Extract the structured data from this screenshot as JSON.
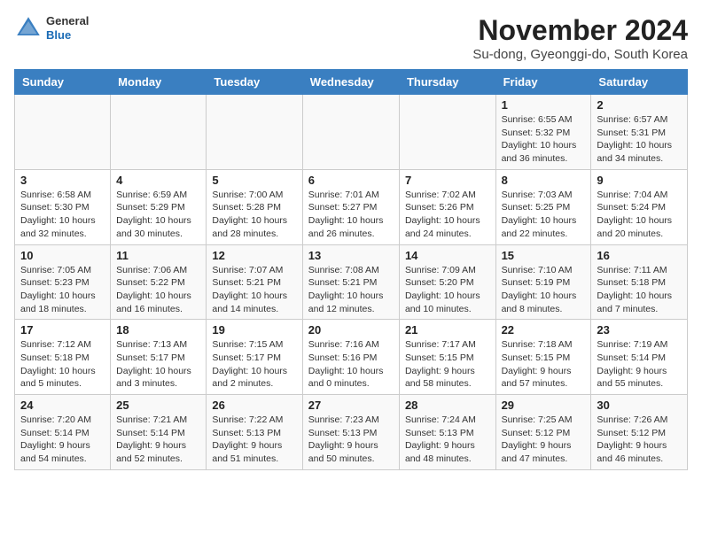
{
  "header": {
    "logo_general": "General",
    "logo_blue": "Blue",
    "title": "November 2024",
    "subtitle": "Su-dong, Gyeonggi-do, South Korea"
  },
  "weekdays": [
    "Sunday",
    "Monday",
    "Tuesday",
    "Wednesday",
    "Thursday",
    "Friday",
    "Saturday"
  ],
  "weeks": [
    [
      {
        "day": "",
        "info": ""
      },
      {
        "day": "",
        "info": ""
      },
      {
        "day": "",
        "info": ""
      },
      {
        "day": "",
        "info": ""
      },
      {
        "day": "",
        "info": ""
      },
      {
        "day": "1",
        "info": "Sunrise: 6:55 AM\nSunset: 5:32 PM\nDaylight: 10 hours and 36 minutes."
      },
      {
        "day": "2",
        "info": "Sunrise: 6:57 AM\nSunset: 5:31 PM\nDaylight: 10 hours and 34 minutes."
      }
    ],
    [
      {
        "day": "3",
        "info": "Sunrise: 6:58 AM\nSunset: 5:30 PM\nDaylight: 10 hours and 32 minutes."
      },
      {
        "day": "4",
        "info": "Sunrise: 6:59 AM\nSunset: 5:29 PM\nDaylight: 10 hours and 30 minutes."
      },
      {
        "day": "5",
        "info": "Sunrise: 7:00 AM\nSunset: 5:28 PM\nDaylight: 10 hours and 28 minutes."
      },
      {
        "day": "6",
        "info": "Sunrise: 7:01 AM\nSunset: 5:27 PM\nDaylight: 10 hours and 26 minutes."
      },
      {
        "day": "7",
        "info": "Sunrise: 7:02 AM\nSunset: 5:26 PM\nDaylight: 10 hours and 24 minutes."
      },
      {
        "day": "8",
        "info": "Sunrise: 7:03 AM\nSunset: 5:25 PM\nDaylight: 10 hours and 22 minutes."
      },
      {
        "day": "9",
        "info": "Sunrise: 7:04 AM\nSunset: 5:24 PM\nDaylight: 10 hours and 20 minutes."
      }
    ],
    [
      {
        "day": "10",
        "info": "Sunrise: 7:05 AM\nSunset: 5:23 PM\nDaylight: 10 hours and 18 minutes."
      },
      {
        "day": "11",
        "info": "Sunrise: 7:06 AM\nSunset: 5:22 PM\nDaylight: 10 hours and 16 minutes."
      },
      {
        "day": "12",
        "info": "Sunrise: 7:07 AM\nSunset: 5:21 PM\nDaylight: 10 hours and 14 minutes."
      },
      {
        "day": "13",
        "info": "Sunrise: 7:08 AM\nSunset: 5:21 PM\nDaylight: 10 hours and 12 minutes."
      },
      {
        "day": "14",
        "info": "Sunrise: 7:09 AM\nSunset: 5:20 PM\nDaylight: 10 hours and 10 minutes."
      },
      {
        "day": "15",
        "info": "Sunrise: 7:10 AM\nSunset: 5:19 PM\nDaylight: 10 hours and 8 minutes."
      },
      {
        "day": "16",
        "info": "Sunrise: 7:11 AM\nSunset: 5:18 PM\nDaylight: 10 hours and 7 minutes."
      }
    ],
    [
      {
        "day": "17",
        "info": "Sunrise: 7:12 AM\nSunset: 5:18 PM\nDaylight: 10 hours and 5 minutes."
      },
      {
        "day": "18",
        "info": "Sunrise: 7:13 AM\nSunset: 5:17 PM\nDaylight: 10 hours and 3 minutes."
      },
      {
        "day": "19",
        "info": "Sunrise: 7:15 AM\nSunset: 5:17 PM\nDaylight: 10 hours and 2 minutes."
      },
      {
        "day": "20",
        "info": "Sunrise: 7:16 AM\nSunset: 5:16 PM\nDaylight: 10 hours and 0 minutes."
      },
      {
        "day": "21",
        "info": "Sunrise: 7:17 AM\nSunset: 5:15 PM\nDaylight: 9 hours and 58 minutes."
      },
      {
        "day": "22",
        "info": "Sunrise: 7:18 AM\nSunset: 5:15 PM\nDaylight: 9 hours and 57 minutes."
      },
      {
        "day": "23",
        "info": "Sunrise: 7:19 AM\nSunset: 5:14 PM\nDaylight: 9 hours and 55 minutes."
      }
    ],
    [
      {
        "day": "24",
        "info": "Sunrise: 7:20 AM\nSunset: 5:14 PM\nDaylight: 9 hours and 54 minutes."
      },
      {
        "day": "25",
        "info": "Sunrise: 7:21 AM\nSunset: 5:14 PM\nDaylight: 9 hours and 52 minutes."
      },
      {
        "day": "26",
        "info": "Sunrise: 7:22 AM\nSunset: 5:13 PM\nDaylight: 9 hours and 51 minutes."
      },
      {
        "day": "27",
        "info": "Sunrise: 7:23 AM\nSunset: 5:13 PM\nDaylight: 9 hours and 50 minutes."
      },
      {
        "day": "28",
        "info": "Sunrise: 7:24 AM\nSunset: 5:13 PM\nDaylight: 9 hours and 48 minutes."
      },
      {
        "day": "29",
        "info": "Sunrise: 7:25 AM\nSunset: 5:12 PM\nDaylight: 9 hours and 47 minutes."
      },
      {
        "day": "30",
        "info": "Sunrise: 7:26 AM\nSunset: 5:12 PM\nDaylight: 9 hours and 46 minutes."
      }
    ]
  ]
}
